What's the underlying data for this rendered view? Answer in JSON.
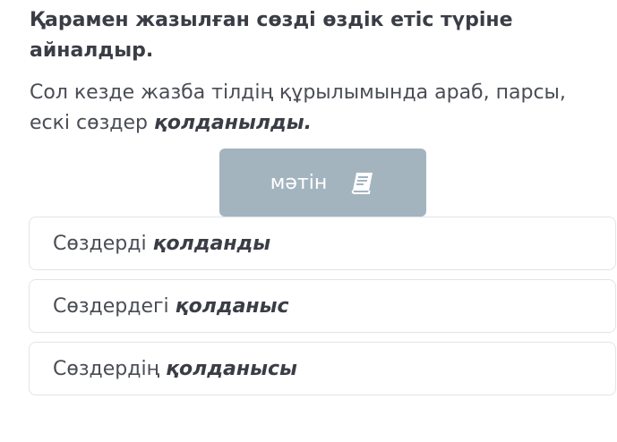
{
  "question": {
    "title": "Қарамен жазылған сөзді өздік етіс түріне айналдыр.",
    "sentence_plain": "Сол кезде жазба тілдің құрылымында араб, парсы, ескі сөздер ",
    "sentence_bold": "қолданылды."
  },
  "text_button": {
    "label": "мәтін",
    "icon": "book-icon"
  },
  "options": [
    {
      "plain": "Сөздерді",
      "bold": "қолданды"
    },
    {
      "plain": "Сөздердегі",
      "bold": "қолданыс"
    },
    {
      "plain": "Сөздердің",
      "bold": "қолданысы"
    }
  ],
  "colors": {
    "button_bg": "#a4b4bf",
    "title_text": "#3a3d45",
    "body_text": "#4a4d55",
    "option_border": "#e2e4e8"
  }
}
